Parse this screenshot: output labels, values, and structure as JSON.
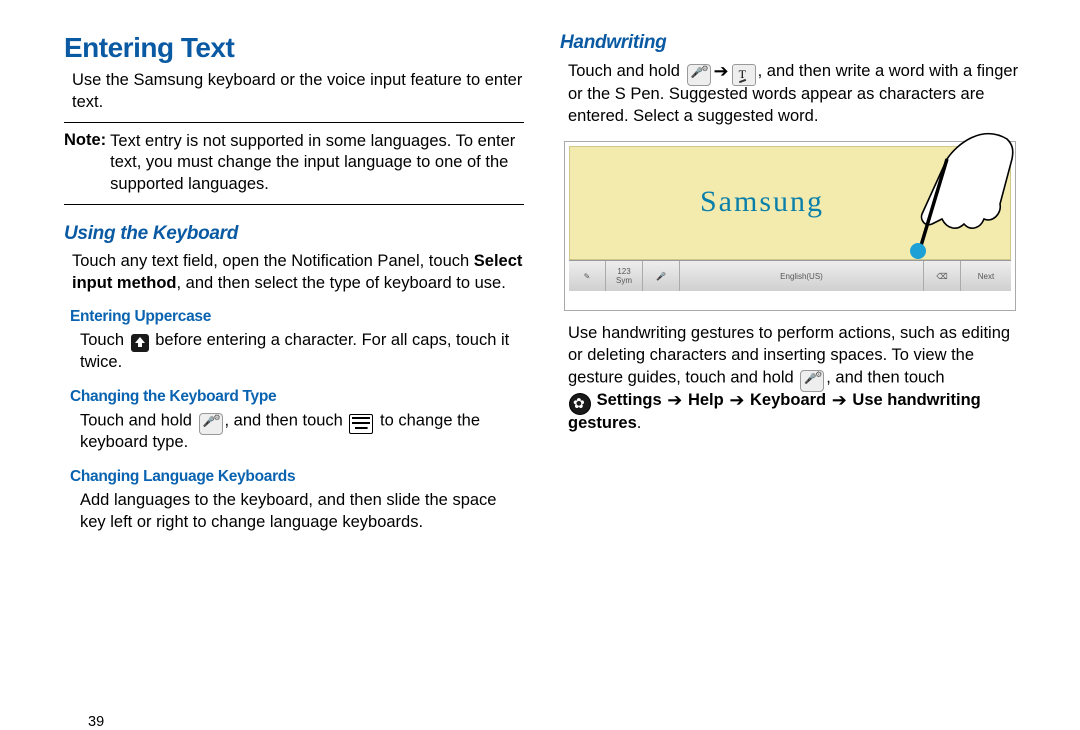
{
  "left": {
    "h1": "Entering Text",
    "intro": "Use the Samsung keyboard or the voice input feature to enter text.",
    "note_label": "Note:",
    "note": "Text entry is not supported in some languages. To enter text, you must change the input language to one of the supported languages.",
    "h2_keyboard": "Using the Keyboard",
    "keyboard_pre": "Touch any text field, open the Notification Panel, touch ",
    "keyboard_bold": "Select input method",
    "keyboard_post": ", and then select the type of keyboard to use.",
    "h3_upper": "Entering Uppercase",
    "upper_a": "Touch ",
    "upper_b": " before entering a character. For all caps, touch it twice.",
    "h3_kbtype": "Changing the Keyboard Type",
    "kbtype_a": "Touch and hold ",
    "kbtype_b": ", and then touch ",
    "kbtype_c": " to change the keyboard type.",
    "h3_lang": "Changing Language Keyboards",
    "lang_body": "Add languages to the keyboard, and then slide the space key left or right to change language keyboards.",
    "pagenum": "39"
  },
  "right": {
    "h2_hw": "Handwriting",
    "hw_a": "Touch and hold ",
    "hw_b": ", and then write a word with a finger or the S Pen. Suggested words appear as characters are entered. Select a suggested word.",
    "illus_text": "Samsung",
    "keybar": {
      "pen": "✎",
      "sym_top": "123",
      "sym_bot": "Sym",
      "mic": "🎤",
      "space": "English(US)",
      "bksp": "⌫",
      "next": "Next"
    },
    "gestures_a": "Use handwriting gestures to perform actions, such as editing or deleting characters and inserting spaces. To view the gesture guides, touch and hold ",
    "gestures_b": ", and then touch",
    "gestures_bold1": "Settings",
    "gestures_arr": "➔",
    "gestures_bold2": "Help",
    "gestures_bold3": "Keyboard",
    "gestures_bold4": "Use handwriting gestures",
    "gestures_end": "."
  }
}
